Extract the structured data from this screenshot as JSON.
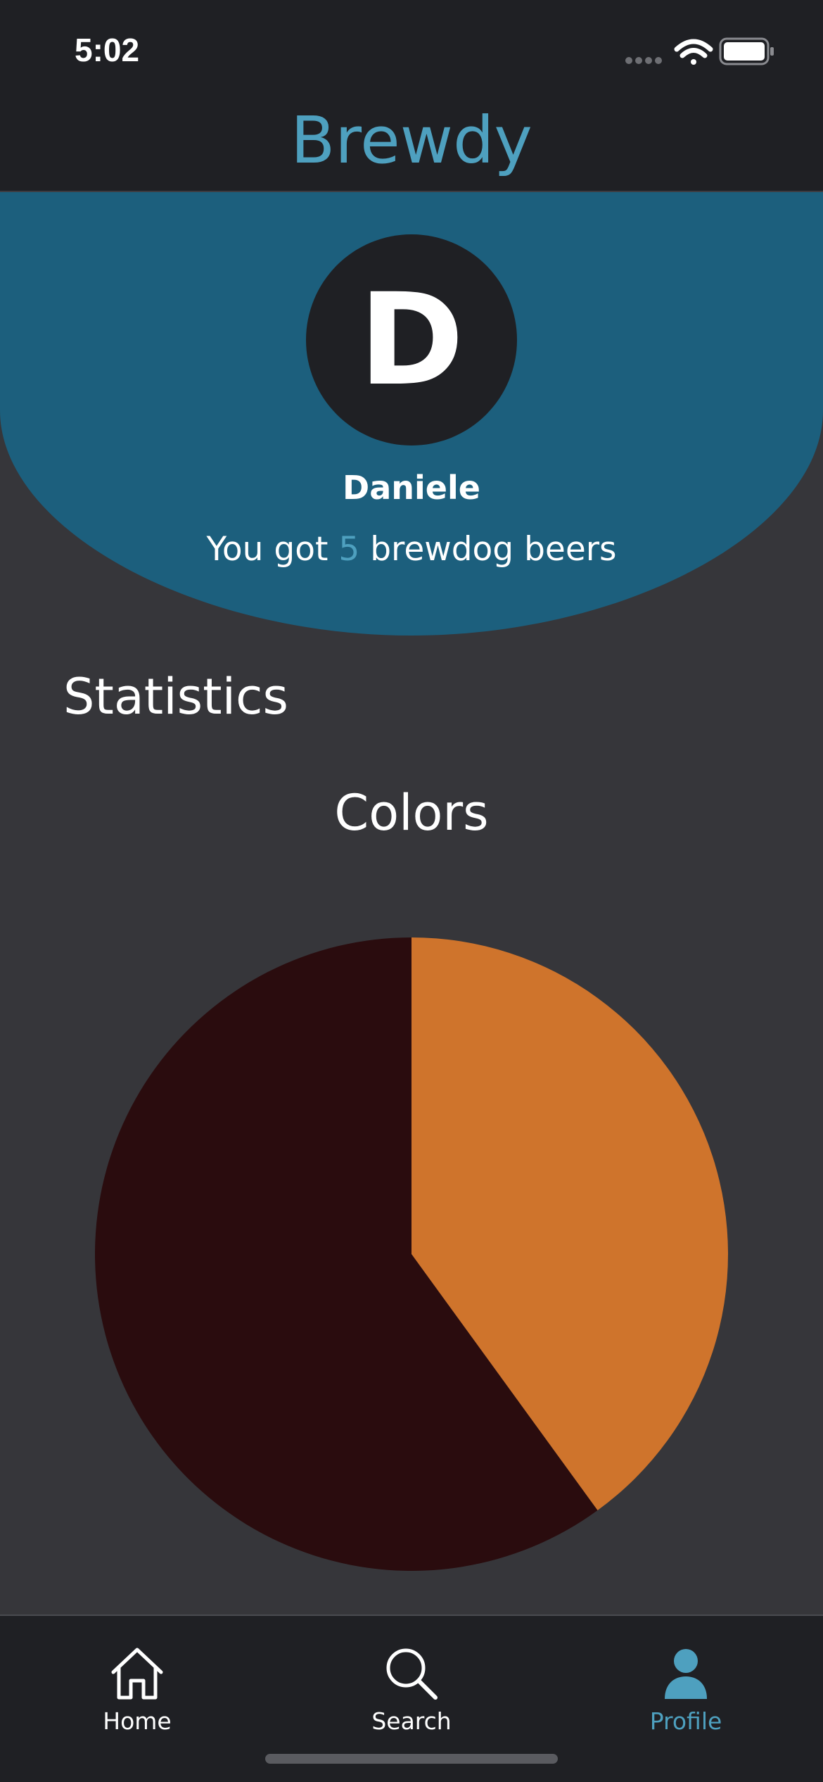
{
  "status_bar": {
    "time": "5:02"
  },
  "header": {
    "title": "Brewdy",
    "title_color": "#4ea0bf"
  },
  "profile": {
    "avatar_initial": "D",
    "name": "Daniele",
    "beer_count_prefix": "You got",
    "beer_count": "5",
    "beer_count_suffix": "brewdog beers",
    "banner_color": "#1c5f7d"
  },
  "statistics": {
    "section_title": "Statistics"
  },
  "chart_data": {
    "type": "pie",
    "title": "Colors",
    "slices": [
      {
        "value": 2,
        "color": "#cf742c"
      },
      {
        "value": 3,
        "color": "#2a0c0e"
      }
    ]
  },
  "tab_bar": {
    "items": [
      {
        "label": "Home",
        "icon": "home-icon",
        "active": false
      },
      {
        "label": "Search",
        "icon": "search-icon",
        "active": false
      },
      {
        "label": "Profile",
        "icon": "profile-icon",
        "active": true
      }
    ],
    "active_color": "#4ea0bf"
  }
}
